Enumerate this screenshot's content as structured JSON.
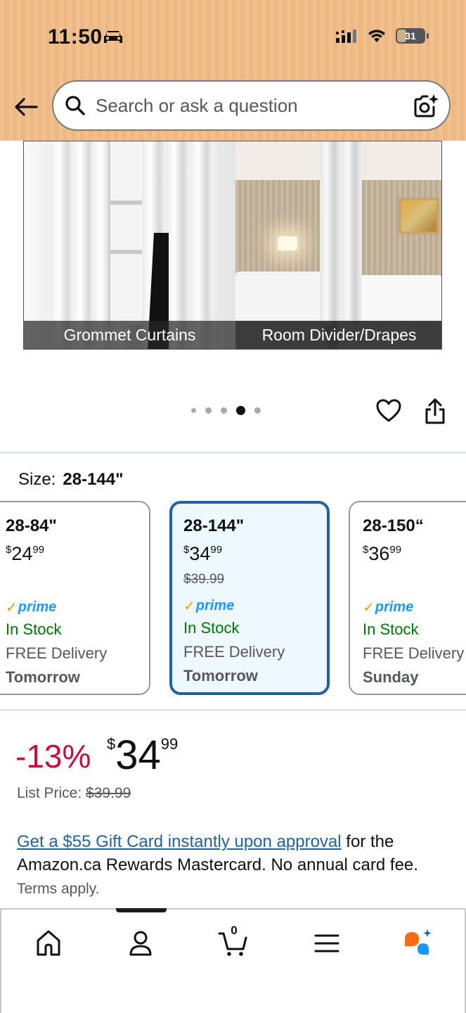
{
  "status_bar": {
    "time": "11:50",
    "battery": "31",
    "icons": [
      "car-icon",
      "cellular-icon",
      "wifi-icon",
      "battery-icon"
    ]
  },
  "search": {
    "placeholder": "Search or ask a question",
    "back_icon": "arrow-left-icon",
    "camera_icon": "camera-sparkle-icon"
  },
  "product_image": {
    "caption_left": "Grommet Curtains",
    "caption_right": "Room Divider/Drapes",
    "dots_total": 5,
    "active_dot": 4
  },
  "size": {
    "label": "Size:",
    "selected": "28-144\"",
    "options": [
      {
        "name": "28-84\"",
        "price_currency": "$",
        "price_whole": "24",
        "price_fraction": "99",
        "old_price": "",
        "prime": "prime",
        "stock": "In Stock",
        "delivery": "FREE Delivery",
        "day": "Tomorrow"
      },
      {
        "name": "28-144\"",
        "price_currency": "$",
        "price_whole": "34",
        "price_fraction": "99",
        "old_price": "$39.99",
        "prime": "prime",
        "stock": "In Stock",
        "delivery": "FREE Delivery",
        "day": "Tomorrow"
      },
      {
        "name": "28-150“",
        "price_currency": "$",
        "price_whole": "36",
        "price_fraction": "99",
        "old_price": "",
        "prime": "prime",
        "stock": "In Stock",
        "delivery": "FREE Delivery",
        "day": "Sunday"
      }
    ]
  },
  "pricing": {
    "discount": "-13%",
    "currency": "$",
    "whole": "34",
    "fraction": "99",
    "list_price_label": "List Price:",
    "list_price_value": "$39.99"
  },
  "promo": {
    "link_text": "Get a $55 Gift Card instantly upon approval",
    "text": " for the Amazon.ca Rewards Mastercard. No annual card fee.",
    "terms": "Terms apply."
  },
  "bottom_nav": {
    "cart_count": "0",
    "items": [
      "home-icon",
      "account-icon",
      "cart-icon",
      "menu-icon",
      "rufus-icon"
    ]
  },
  "colors": {
    "header_bg": "#f2c08c",
    "selected_border": "#2162a1",
    "selected_bg": "#edf8ff",
    "discount": "#cc0c39",
    "in_stock": "#007600",
    "link": "#2162a1",
    "prime_blue": "#1a98ff",
    "prime_check": "#ff9900"
  }
}
